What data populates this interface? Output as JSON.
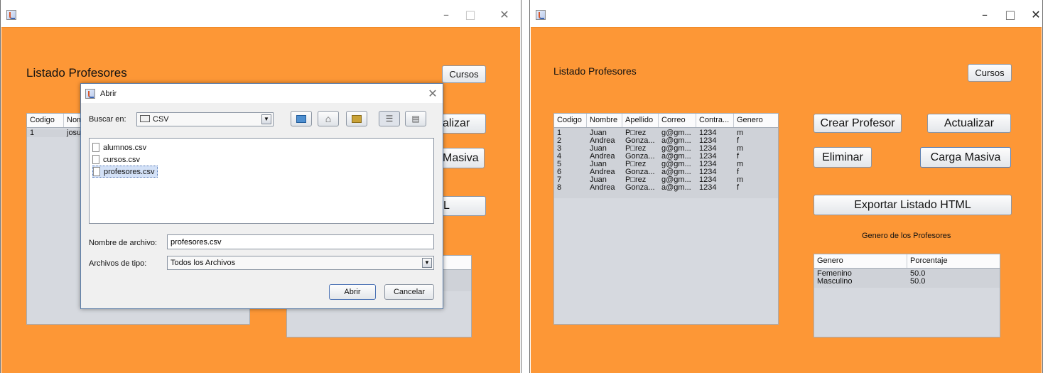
{
  "left_window": {
    "heading": "Listado Profesores",
    "buttons": {
      "cursos": "Cursos",
      "actualizar_partial": "alizar",
      "carga_masiva_partial": "Masiva",
      "exportar_partial": "L"
    },
    "table": {
      "headers": [
        "Codigo",
        "Nom"
      ],
      "rows": [
        [
          "1",
          "josu"
        ]
      ]
    }
  },
  "dialog": {
    "title": "Abrir",
    "look_in_label": "Buscar en:",
    "look_in_value": "CSV",
    "files": [
      "alumnos.csv",
      "cursos.csv",
      "profesores.csv"
    ],
    "selected_file": "profesores.csv",
    "file_name_label": "Nombre de archivo:",
    "file_name_value": "profesores.csv",
    "file_type_label": "Archivos de tipo:",
    "file_type_value": "Todos los Archivos",
    "open_button": "Abrir",
    "cancel_button": "Cancelar"
  },
  "right_window": {
    "heading": "Listado Profesores",
    "buttons": {
      "cursos": "Cursos",
      "crear": "Crear Profesor",
      "actualizar": "Actualizar",
      "eliminar": "Eliminar",
      "carga_masiva": "Carga Masiva",
      "exportar": "Exportar Listado HTML"
    },
    "table": {
      "headers": [
        "Codigo",
        "Nombre",
        "Apellido",
        "Correo",
        "Contra...",
        "Genero"
      ],
      "rows": [
        [
          "1",
          "Juan",
          "P□rez",
          "g@gm...",
          "1234",
          "m"
        ],
        [
          "2",
          "Andrea",
          "Gonza...",
          "a@gm...",
          "1234",
          "f"
        ],
        [
          "3",
          "Juan",
          "P□rez",
          "g@gm...",
          "1234",
          "m"
        ],
        [
          "4",
          "Andrea",
          "Gonza...",
          "a@gm...",
          "1234",
          "f"
        ],
        [
          "5",
          "Juan",
          "P□rez",
          "g@gm...",
          "1234",
          "m"
        ],
        [
          "6",
          "Andrea",
          "Gonza...",
          "a@gm...",
          "1234",
          "f"
        ],
        [
          "7",
          "Juan",
          "P□rez",
          "g@gm...",
          "1234",
          "m"
        ],
        [
          "8",
          "Andrea",
          "Gonza...",
          "a@gm...",
          "1234",
          "f"
        ]
      ]
    },
    "gender_caption": "Genero de los Profesores",
    "gender_table": {
      "headers": [
        "Genero",
        "Porcentaje"
      ],
      "rows": [
        [
          "Femenino",
          "50.0"
        ],
        [
          "Masculino",
          "50.0"
        ]
      ]
    }
  },
  "window_controls": {
    "minimize": "–",
    "maximize": "□",
    "close": "✕"
  },
  "colors": {
    "background": "#fd9736",
    "table_bg": "#d6d9df"
  }
}
